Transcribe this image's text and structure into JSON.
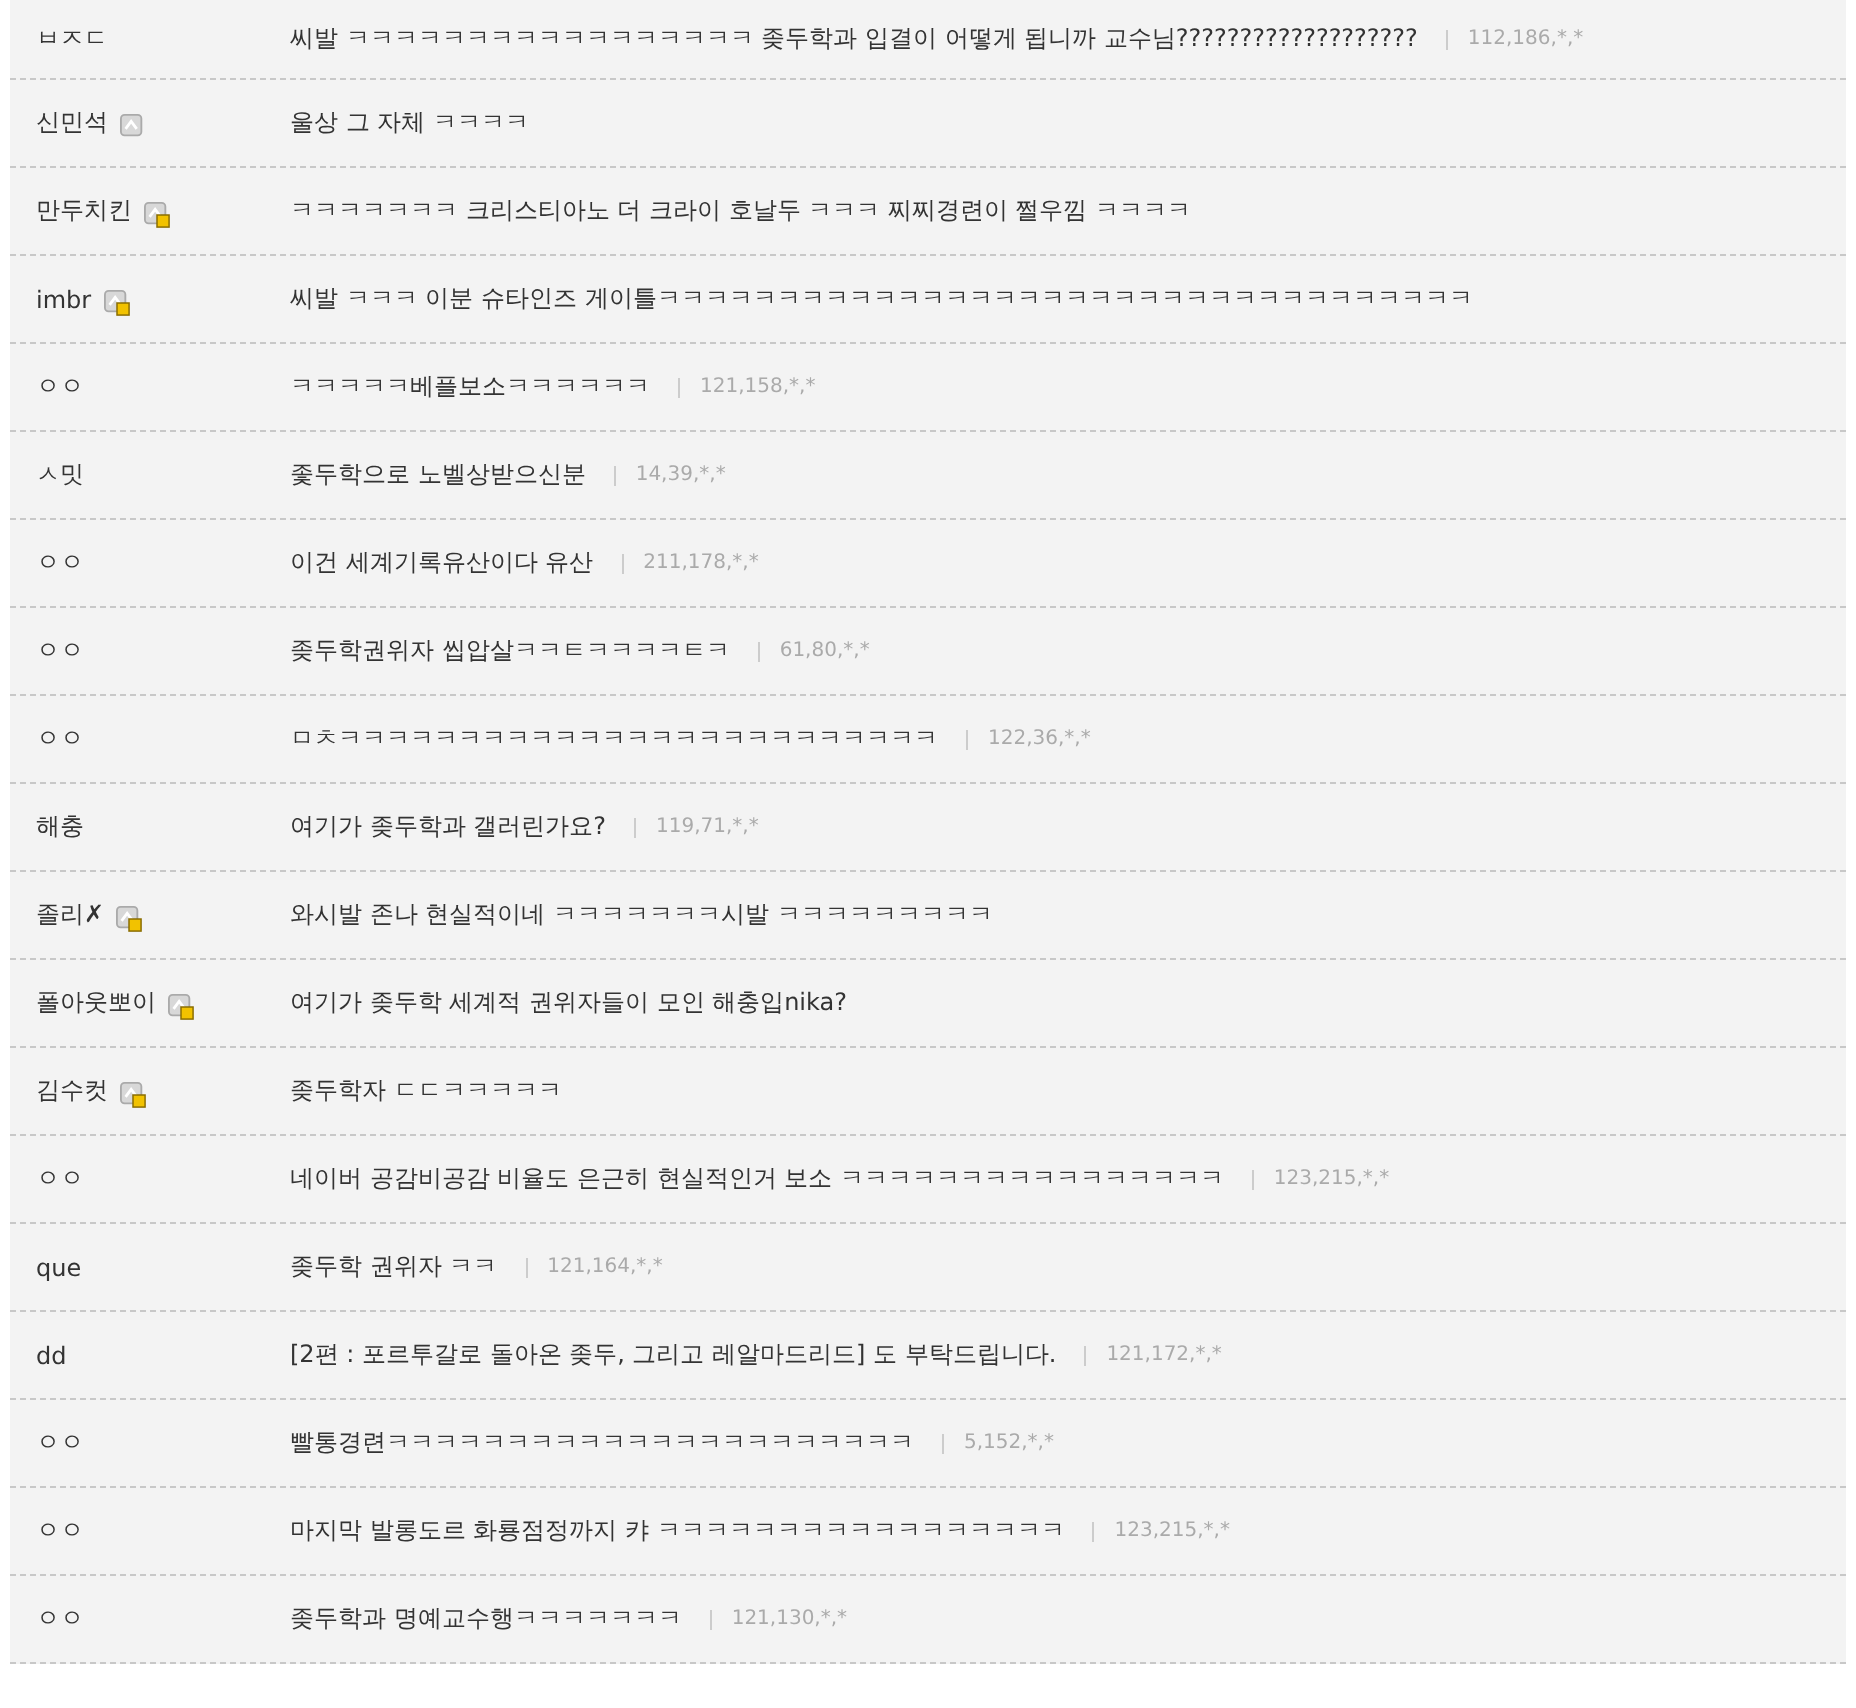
{
  "comments": [
    {
      "author": "ㅂㅈㄷ",
      "text": "씨발 ㅋㅋㅋㅋㅋㅋㅋㅋㅋㅋㅋㅋㅋㅋㅋㅋㅋ 좆두학과 입결이 어떻게 됩니까 교수님???????????????????",
      "ip": "112,186,*,*"
    },
    {
      "author": "신민석",
      "member_icon": true,
      "fixed_nick": false,
      "text": "울상 그 자체 ㅋㅋㅋㅋ"
    },
    {
      "author": "만두치킨",
      "member_icon": true,
      "fixed_nick": true,
      "text": "ㅋㅋㅋㅋㅋㅋㅋ 크리스티아노 더 크라이 호날두 ㅋㅋㅋ 찌찌경련이 쩔우낌 ㅋㅋㅋㅋ"
    },
    {
      "author": "imbr",
      "member_icon": true,
      "fixed_nick": true,
      "text": "씨발 ㅋㅋㅋ 이분 슈타인즈 게이틀ㅋㅋㅋㅋㅋㅋㅋㅋㅋㅋㅋㅋㅋㅋㅋㅋㅋㅋㅋㅋㅋㅋㅋㅋㅋㅋㅋㅋㅋㅋㅋㅋㅋㅋ"
    },
    {
      "author": "ㅇㅇ",
      "text": "ㅋㅋㅋㅋㅋ베플보소ㅋㅋㅋㅋㅋㅋ",
      "ip": "121,158,*,*"
    },
    {
      "author": "ㅅ밋",
      "text": "좇두학으로 노벨상받으신분",
      "ip": "14,39,*,*"
    },
    {
      "author": "ㅇㅇ",
      "text": "이건 세계기록유산이다 유산",
      "ip": "211,178,*,*"
    },
    {
      "author": "ㅇㅇ",
      "text": "좆두학권위자 씹압살ㅋㅋㅌㅋㅋㅋㅋㅌㅋ",
      "ip": "61,80,*,*"
    },
    {
      "author": "ㅇㅇ",
      "text": "ㅁㅊㅋㅋㅋㅋㅋㅋㅋㅋㅋㅋㅋㅋㅋㅋㅋㅋㅋㅋㅋㅋㅋㅋㅋㅋㅋ",
      "ip": "122,36,*,*"
    },
    {
      "author": "해충",
      "text": "여기가 좆두학과 갤러린가요?",
      "ip": "119,71,*,*"
    },
    {
      "author": "졸리✗",
      "member_icon": true,
      "fixed_nick": true,
      "text": "와시발 존나 현실적이네 ㅋㅋㅋㅋㅋㅋㅋ시발 ㅋㅋㅋㅋㅋㅋㅋㅋㅋ"
    },
    {
      "author": "폴아웃뽀이",
      "member_icon": true,
      "fixed_nick": true,
      "text": "여기가 좆두학 세계적 권위자들이 모인 해충입nika?"
    },
    {
      "author": "김수컷",
      "member_icon": true,
      "fixed_nick": true,
      "text": "좆두학자 ㄷㄷㅋㅋㅋㅋㅋ"
    },
    {
      "author": "ㅇㅇ",
      "text": "네이버 공감비공감 비율도 은근히 현실적인거 보소 ㅋㅋㅋㅋㅋㅋㅋㅋㅋㅋㅋㅋㅋㅋㅋㅋ",
      "ip": "123,215,*,*"
    },
    {
      "author": "que",
      "text": "좆두학 권위자 ㅋㅋ",
      "ip": "121,164,*,*"
    },
    {
      "author": "dd",
      "text": "[2편 : 포르투갈로 돌아온 좆두, 그리고 레알마드리드] 도 부탁드립니다.",
      "ip": "121,172,*,*"
    },
    {
      "author": "ㅇㅇ",
      "text": "빨통경련ㅋㅋㅋㅋㅋㅋㅋㅋㅋㅋㅋㅋㅋㅋㅋㅋㅋㅋㅋㅋㅋㅋ",
      "ip": "5,152,*,*"
    },
    {
      "author": "ㅇㅇ",
      "text": "마지막 발롱도르 화룡점정까지 캬 ㅋㅋㅋㅋㅋㅋㅋㅋㅋㅋㅋㅋㅋㅋㅋㅋㅋ",
      "ip": "123,215,*,*"
    },
    {
      "author": "ㅇㅇ",
      "text": "좆두학과 명예교수행ㅋㅋㅋㅋㅋㅋㅋ",
      "ip": "121,130,*,*"
    }
  ]
}
